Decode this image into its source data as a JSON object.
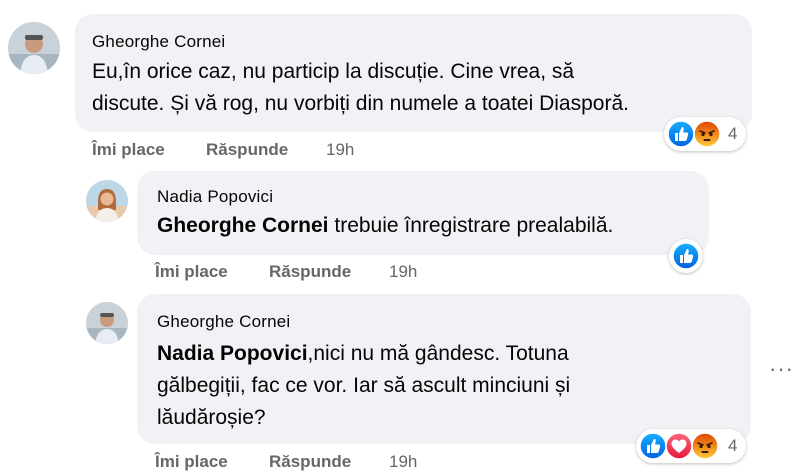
{
  "comments": [
    {
      "author": "Gheorghe Cornei",
      "line1": "Eu,în orice caz, nu particip la discuție. Cine vrea, să",
      "line2": "discute. Și vă rog, nu vorbiți din numele a toatei Diasporă.",
      "like_label": "Îmi place",
      "reply_label": "Răspunde",
      "time": "19h",
      "reaction_count": "4",
      "reactions": [
        "like-icon",
        "angry-icon"
      ]
    },
    {
      "author": "Nadia Popovici",
      "mention": "Gheorghe Cornei",
      "text": " trebuie înregistrare prealabilă.",
      "like_label": "Îmi place",
      "reply_label": "Răspunde",
      "time": "19h",
      "reactions": [
        "like-icon"
      ]
    },
    {
      "author": "Gheorghe Cornei",
      "mention": "Nadia Popovici",
      "text1": ",nici nu mă gândesc. Totuna",
      "line2": "gălbegiții, fac ce vor. Iar să ascult minciuni și",
      "line3": "lăudăroșie?",
      "like_label": "Îmi place",
      "reply_label": "Răspunde",
      "time": "19h",
      "reaction_count": "4",
      "reactions": [
        "like-icon",
        "love-icon",
        "angry-icon"
      ]
    }
  ],
  "more_options": "···",
  "colors": {
    "bubble": "#f0f2f5",
    "like": "#1877f2",
    "love": "#f33e58",
    "angry": "#e9710f",
    "secondary_text": "#65676b"
  }
}
